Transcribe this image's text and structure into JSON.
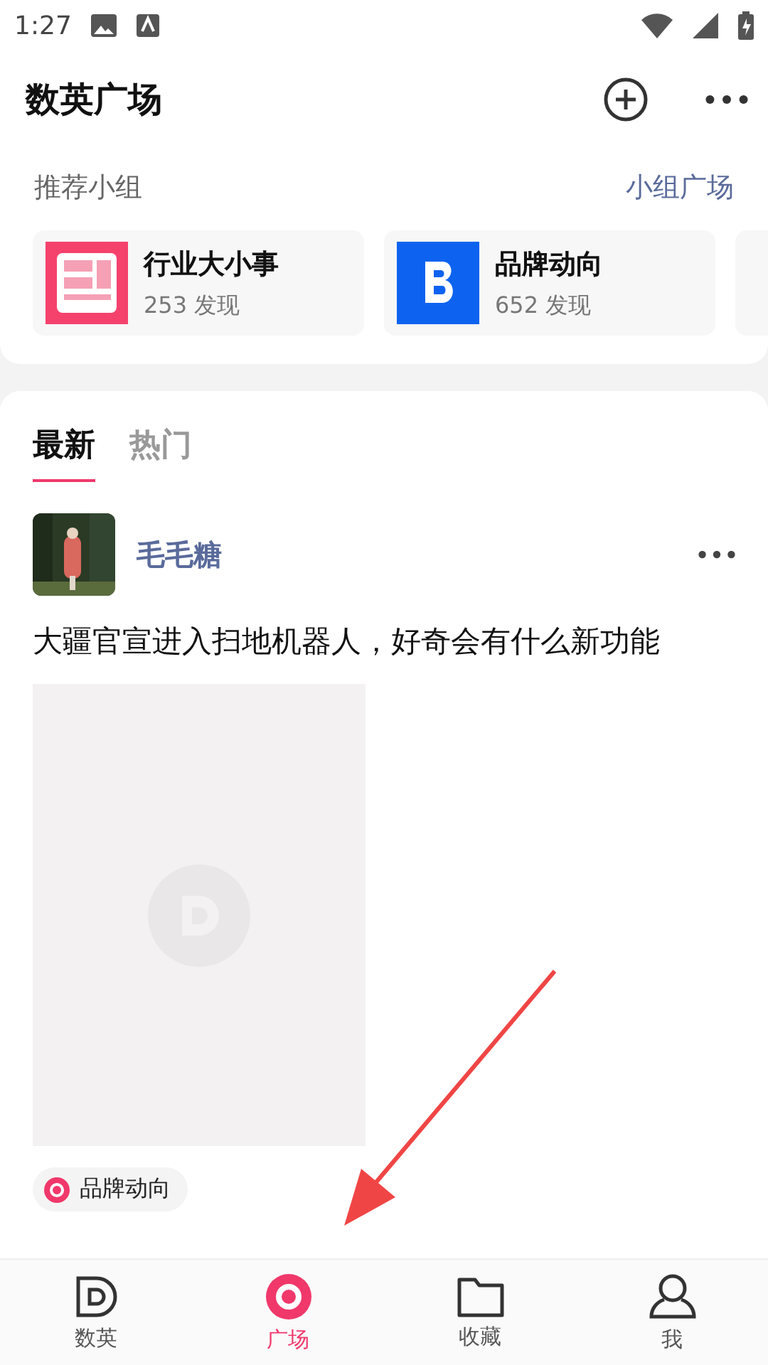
{
  "status_bar": {
    "time": "1:27"
  },
  "header": {
    "title": "数英广场"
  },
  "groups_section": {
    "label": "推荐小组",
    "link": "小组广场",
    "groups": [
      {
        "name": "行业大小事",
        "count": "253 发现"
      },
      {
        "name": "品牌动向",
        "count": "652 发现"
      }
    ]
  },
  "tabs": [
    {
      "label": "最新",
      "selected": true
    },
    {
      "label": "热门",
      "selected": false
    }
  ],
  "post": {
    "author": "毛毛糖",
    "text": "大疆官宣进入扫地机器人，好奇会有什么新功能",
    "tag": "品牌动向"
  },
  "bottom_nav": [
    {
      "label": "数英",
      "selected": false
    },
    {
      "label": "广场",
      "selected": true
    },
    {
      "label": "收藏",
      "selected": false
    },
    {
      "label": "我",
      "selected": false
    }
  ]
}
